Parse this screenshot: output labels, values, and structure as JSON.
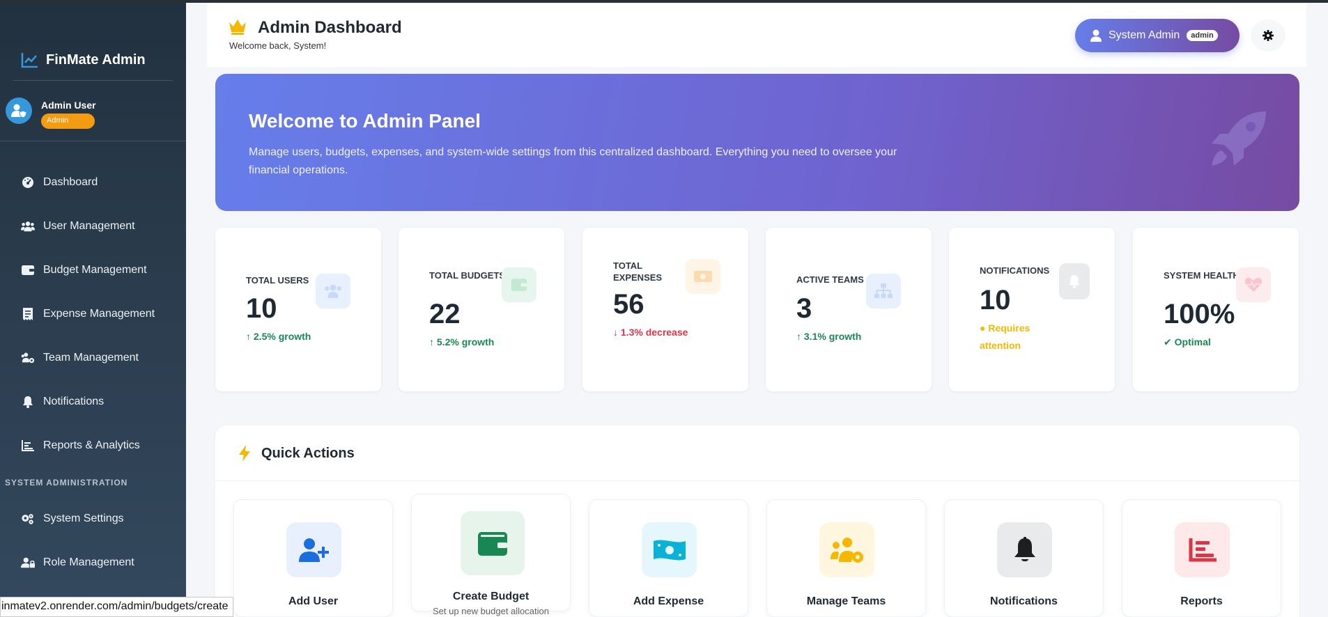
{
  "sidebar": {
    "brand": "FinMate Admin",
    "user": {
      "name": "Admin User",
      "role": "Admin"
    },
    "items": [
      {
        "label": "Dashboard",
        "icon": "dashboard-icon"
      },
      {
        "label": "User Management",
        "icon": "users-icon"
      },
      {
        "label": "Budget Management",
        "icon": "wallet-icon"
      },
      {
        "label": "Expense Management",
        "icon": "receipt-icon"
      },
      {
        "label": "Team Management",
        "icon": "team-icon"
      },
      {
        "label": "Notifications",
        "icon": "bell-icon"
      },
      {
        "label": "Reports & Analytics",
        "icon": "chart-icon"
      }
    ],
    "section_label": "SYSTEM ADMINISTRATION",
    "admin_items": [
      {
        "label": "System Settings",
        "icon": "gears-icon"
      },
      {
        "label": "Role Management",
        "icon": "user-lock-icon"
      }
    ]
  },
  "status_bar": {
    "url": "inmatev2.onrender.com/admin/budgets/create"
  },
  "header": {
    "title": "Admin Dashboard",
    "subtitle": "Welcome back, System!",
    "user_name": "System Admin",
    "user_tag": "admin"
  },
  "banner": {
    "title": "Welcome to Admin Panel",
    "text": "Manage users, budgets, expenses, and system-wide settings from this centralized dashboard. Everything you need to oversee your financial operations."
  },
  "stats": [
    {
      "label": "Total Users",
      "value": "10",
      "trend": "2.5% growth",
      "direction": "up",
      "icon": "users-icon"
    },
    {
      "label": "Total Budgets",
      "value": "22",
      "trend": "5.2% growth",
      "direction": "up",
      "icon": "wallet-icon"
    },
    {
      "label": "Total Expenses",
      "value": "56",
      "trend": "1.3% decrease",
      "direction": "down",
      "icon": "money-icon"
    },
    {
      "label": "Active Teams",
      "value": "3",
      "trend": "3.1% growth",
      "direction": "up",
      "icon": "sitemap-icon"
    },
    {
      "label": "Notifications",
      "value": "10",
      "trend": "Requires attention",
      "direction": "warn",
      "icon": "bell-icon"
    },
    {
      "label": "System Health",
      "value": "100%",
      "trend": "Optimal",
      "direction": "ok",
      "icon": "heart-pulse-icon"
    }
  ],
  "colors": {
    "up": "#198754",
    "down": "#dc3545",
    "warn": "#f5b800",
    "accent": "#667eea",
    "accent2": "#764ba2"
  },
  "quick_actions": {
    "title": "Quick Actions",
    "items": [
      {
        "label": "Add User",
        "desc": "",
        "icon": "user-plus-icon"
      },
      {
        "label": "Create Budget",
        "desc": "Set up new budget allocation",
        "icon": "wallet-icon"
      },
      {
        "label": "Add Expense",
        "desc": "",
        "icon": "money-bill-icon"
      },
      {
        "label": "Manage Teams",
        "desc": "",
        "icon": "users-cog-icon"
      },
      {
        "label": "Notifications",
        "desc": "",
        "icon": "bell-icon"
      },
      {
        "label": "Reports",
        "desc": "",
        "icon": "chart-bar-icon"
      }
    ]
  }
}
